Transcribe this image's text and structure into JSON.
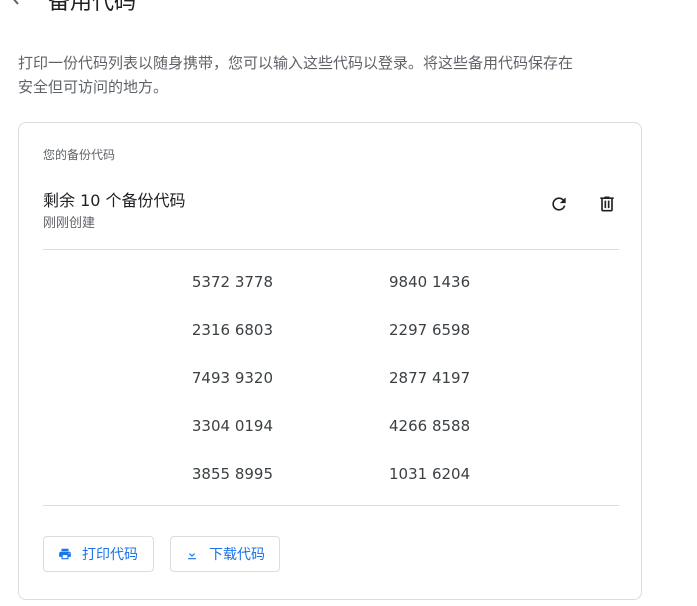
{
  "header": {
    "title": "备用代码"
  },
  "description": "打印一份代码列表以随身携带，您可以输入这些代码以登录。将这些备用代码保存在安全但可访问的地方。",
  "card": {
    "label": "您的备份代码",
    "remaining": "剩余 10 个备份代码",
    "created": "刚刚创建",
    "codes": [
      [
        "5372 3778",
        "9840 1436"
      ],
      [
        "2316 6803",
        "2297 6598"
      ],
      [
        "7493 9320",
        "2877 4197"
      ],
      [
        "3304 0194",
        "4266 8588"
      ],
      [
        "3855 8995",
        "1031 6204"
      ]
    ],
    "print_label": "打印代码",
    "download_label": "下载代码"
  },
  "icons": {
    "back": "arrow-back-icon",
    "refresh": "refresh-icon",
    "delete": "trash-icon",
    "print": "printer-icon",
    "download": "download-icon"
  },
  "colors": {
    "accent": "#1a73e8",
    "text_primary": "#202124",
    "text_secondary": "#5f6368",
    "border": "#dadce0"
  }
}
